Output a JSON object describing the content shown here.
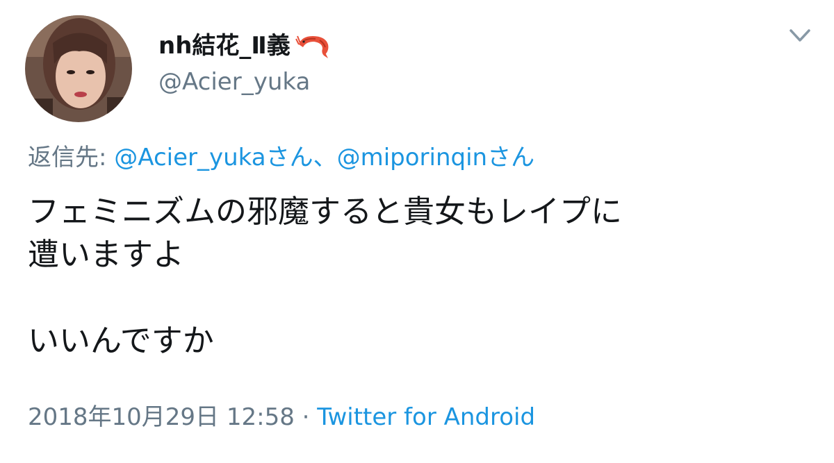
{
  "user": {
    "display_name": "nh結花_Ⅱ義",
    "handle": "@Acier_yuka",
    "avatar_icon": "user-avatar-photo",
    "badge_icon": "shrimp-emoji-icon"
  },
  "reply_to": {
    "prefix": "返信先:",
    "mention1": "@Acier_yukaさん",
    "separator": "、",
    "mention2": "@miporinqinさん"
  },
  "tweet": {
    "line1": "フェミニズムの邪魔すると貴女もレイプに",
    "line2": "遭いますよ",
    "line3": "いいんですか"
  },
  "meta": {
    "timestamp": "2018年10月29日 12:58",
    "dot": " · ",
    "source": "Twitter for Android"
  },
  "colors": {
    "text": "#14171a",
    "secondary": "#657786",
    "link": "#1b95e0",
    "background": "#ffffff"
  },
  "icons": {
    "menu": "chevron-down-icon"
  }
}
